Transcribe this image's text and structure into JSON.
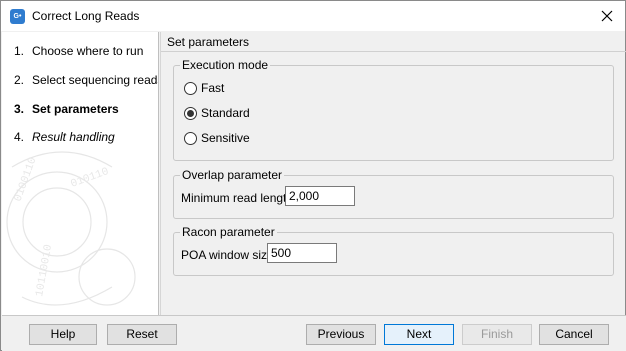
{
  "window": {
    "title": "Correct Long Reads",
    "app_icon_text": "G•"
  },
  "steps": [
    {
      "num": "1.",
      "label": "Choose where to run",
      "style": "normal"
    },
    {
      "num": "2.",
      "label": "Select sequencing reads",
      "style": "normal"
    },
    {
      "num": "3.",
      "label": "Set parameters",
      "style": "bold"
    },
    {
      "num": "4.",
      "label": "Result handling",
      "style": "italic"
    }
  ],
  "main": {
    "heading": "Set parameters",
    "execution_mode": {
      "legend": "Execution mode",
      "options": [
        {
          "label": "Fast",
          "checked": false
        },
        {
          "label": "Standard",
          "checked": true
        },
        {
          "label": "Sensitive",
          "checked": false
        }
      ]
    },
    "overlap": {
      "legend": "Overlap parameter",
      "min_read_length_label": "Minimum read length",
      "min_read_length_value": "2,000"
    },
    "racon": {
      "legend": "Racon parameter",
      "poa_window_label": "POA window size",
      "poa_window_value": "500"
    }
  },
  "buttons": {
    "help": "Help",
    "reset": "Reset",
    "previous": "Previous",
    "next": "Next",
    "finish": "Finish",
    "cancel": "Cancel"
  },
  "icons": {
    "close": "close-icon",
    "app": "app-logo-icon",
    "watermark": "dna-watermark-icon"
  },
  "colors": {
    "accent": "#0078d7",
    "app_icon": "#2f7ccf",
    "disabled_text": "#9a9a9a"
  }
}
